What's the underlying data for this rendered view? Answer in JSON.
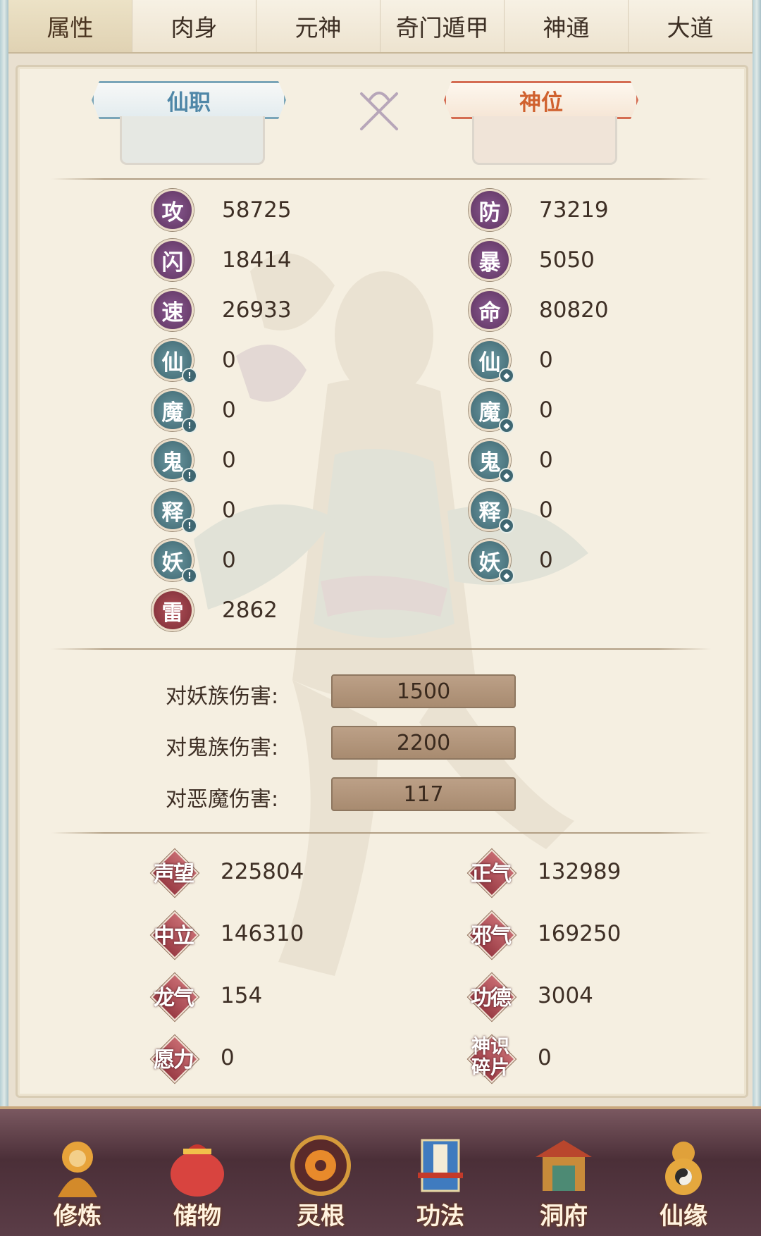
{
  "tabs": [
    "属性",
    "肉身",
    "元神",
    "奇门遁甲",
    "神通",
    "大道"
  ],
  "header": {
    "left_title": "仙职",
    "right_title": "神位"
  },
  "attributes": {
    "left": [
      {
        "name": "攻",
        "value": "58725",
        "color": "purple"
      },
      {
        "name": "闪",
        "value": "18414",
        "color": "purple"
      },
      {
        "name": "速",
        "value": "26933",
        "color": "purple"
      },
      {
        "name": "仙",
        "value": "0",
        "color": "teal",
        "mark": "!"
      },
      {
        "name": "魔",
        "value": "0",
        "color": "teal",
        "mark": "!"
      },
      {
        "name": "鬼",
        "value": "0",
        "color": "teal",
        "mark": "!"
      },
      {
        "name": "释",
        "value": "0",
        "color": "teal",
        "mark": "!"
      },
      {
        "name": "妖",
        "value": "0",
        "color": "teal",
        "mark": "!"
      },
      {
        "name": "雷",
        "value": "2862",
        "color": "red"
      }
    ],
    "right": [
      {
        "name": "防",
        "value": "73219",
        "color": "purple"
      },
      {
        "name": "暴",
        "value": "5050",
        "color": "purple"
      },
      {
        "name": "命",
        "value": "80820",
        "color": "purple"
      },
      {
        "name": "仙",
        "value": "0",
        "color": "teal",
        "mark": "shield"
      },
      {
        "name": "魔",
        "value": "0",
        "color": "teal",
        "mark": "shield"
      },
      {
        "name": "鬼",
        "value": "0",
        "color": "teal",
        "mark": "shield"
      },
      {
        "name": "释",
        "value": "0",
        "color": "teal",
        "mark": "shield"
      },
      {
        "name": "妖",
        "value": "0",
        "color": "teal",
        "mark": "shield"
      }
    ]
  },
  "damage": [
    {
      "label": "对妖族伤害:",
      "value": "1500"
    },
    {
      "label": "对鬼族伤害:",
      "value": "2200"
    },
    {
      "label": "对恶魔伤害:",
      "value": "117"
    }
  ],
  "reputation": {
    "left": [
      {
        "name": "声望",
        "value": "225804"
      },
      {
        "name": "中立",
        "value": "146310"
      },
      {
        "name": "龙气",
        "value": "154"
      },
      {
        "name": "愿力",
        "value": "0"
      }
    ],
    "right": [
      {
        "name": "正气",
        "value": "132989"
      },
      {
        "name": "邪气",
        "value": "169250"
      },
      {
        "name": "功德",
        "value": "3004"
      },
      {
        "name": "神识碎片",
        "value": "0"
      }
    ]
  },
  "bottom_nav": [
    "修炼",
    "储物",
    "灵根",
    "功法",
    "洞府",
    "仙缘"
  ],
  "colors": {
    "purple": "#6f4271",
    "teal": "#4f7d87",
    "red": "#8f3a43",
    "accent_blue": "#4f87a8",
    "accent_orange": "#d0612e"
  }
}
